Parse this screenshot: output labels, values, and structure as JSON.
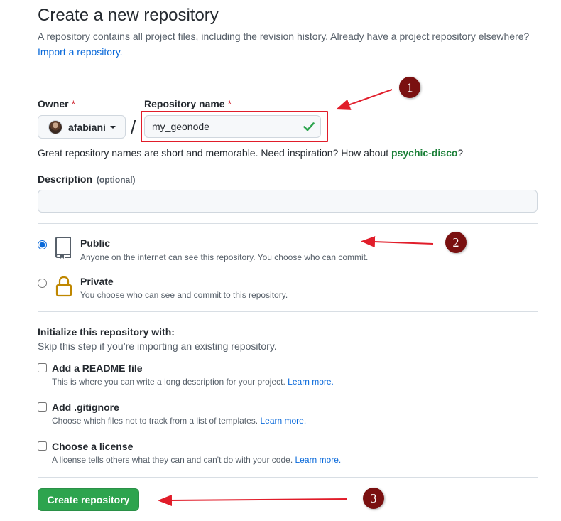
{
  "header": {
    "title": "Create a new repository",
    "subtitle": "A repository contains all project files, including the revision history. Already have a project repository elsewhere?",
    "import_link": "Import a repository."
  },
  "owner": {
    "label": "Owner",
    "required_mark": "*",
    "value": "afabiani"
  },
  "repository": {
    "label": "Repository name",
    "required_mark": "*",
    "value": "my_geonode",
    "slash": "/"
  },
  "hint": {
    "text": "Great repository names are short and memorable. Need inspiration? How about",
    "suggestion": "psychic-disco",
    "end": "?"
  },
  "description": {
    "label": "Description",
    "optional": "(optional)",
    "value": ""
  },
  "visibility": {
    "selected": "public",
    "options": [
      {
        "title": "Public",
        "note": "Anyone on the internet can see this repository. You choose who can commit.",
        "icon": "repo-icon"
      },
      {
        "title": "Private",
        "note": "You choose who can see and commit to this repository.",
        "icon": "lock-icon"
      }
    ]
  },
  "initialize": {
    "title": "Initialize this repository with:",
    "subtitle": "Skip this step if you’re importing an existing repository.",
    "options": [
      {
        "label": "Add a README file",
        "note": "This is where you can write a long description for your project.",
        "link": "Learn more.",
        "checked": false
      },
      {
        "label": "Add .gitignore",
        "note": "Choose which files not to track from a list of templates.",
        "link": "Learn more.",
        "checked": false
      },
      {
        "label": "Choose a license",
        "note": "A license tells others what they can and can't do with your code.",
        "link": "Learn more.",
        "checked": false
      }
    ]
  },
  "submit": {
    "label": "Create repository"
  },
  "annotations": {
    "badges": [
      "1",
      "2",
      "3"
    ]
  },
  "colors": {
    "primary_button": "#2da44e",
    "link": "#0969da",
    "suggestion": "#1a7f37",
    "annotation_red": "#e11d2a",
    "badge": "#7a1010"
  }
}
